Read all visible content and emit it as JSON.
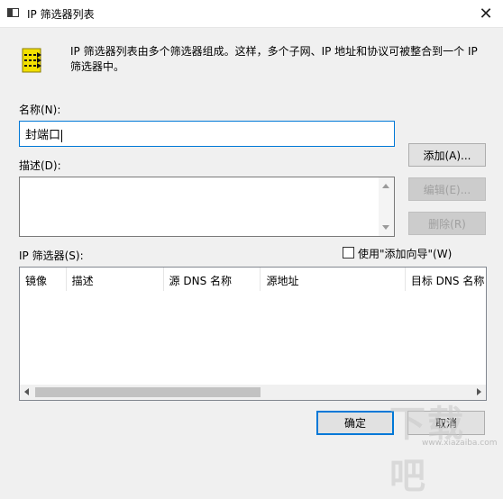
{
  "window": {
    "title": "IP 筛选器列表",
    "close_glyph": "✕"
  },
  "header": {
    "icon": "filter-list-icon",
    "description": "IP 筛选器列表由多个筛选器组成。这样，多个子网、IP 地址和协议可被整合到一个 IP 筛选器中。"
  },
  "name_section": {
    "label": "名称(N):",
    "value": "封端口"
  },
  "description_section": {
    "label": "描述(D):",
    "value": ""
  },
  "side_buttons": {
    "add": "添加(A)...",
    "edit": "编辑(E)...",
    "delete": "删除(R)"
  },
  "filters_section": {
    "label": "IP 筛选器(S):",
    "wizard_checkbox_label": "使用\"添加向导\"(W)",
    "wizard_checked": false,
    "columns": [
      "镜像",
      "描述",
      "源 DNS 名称",
      "源地址",
      "目标 DNS 名称"
    ],
    "rows": []
  },
  "footer": {
    "ok": "确定",
    "cancel": "取消"
  },
  "watermark": {
    "text": "下载吧",
    "url": "www.xiazaiba.com"
  },
  "colors": {
    "accent": "#0078d7",
    "dialog_bg": "#f0f0f0",
    "icon_yellow": "#f2e000"
  }
}
